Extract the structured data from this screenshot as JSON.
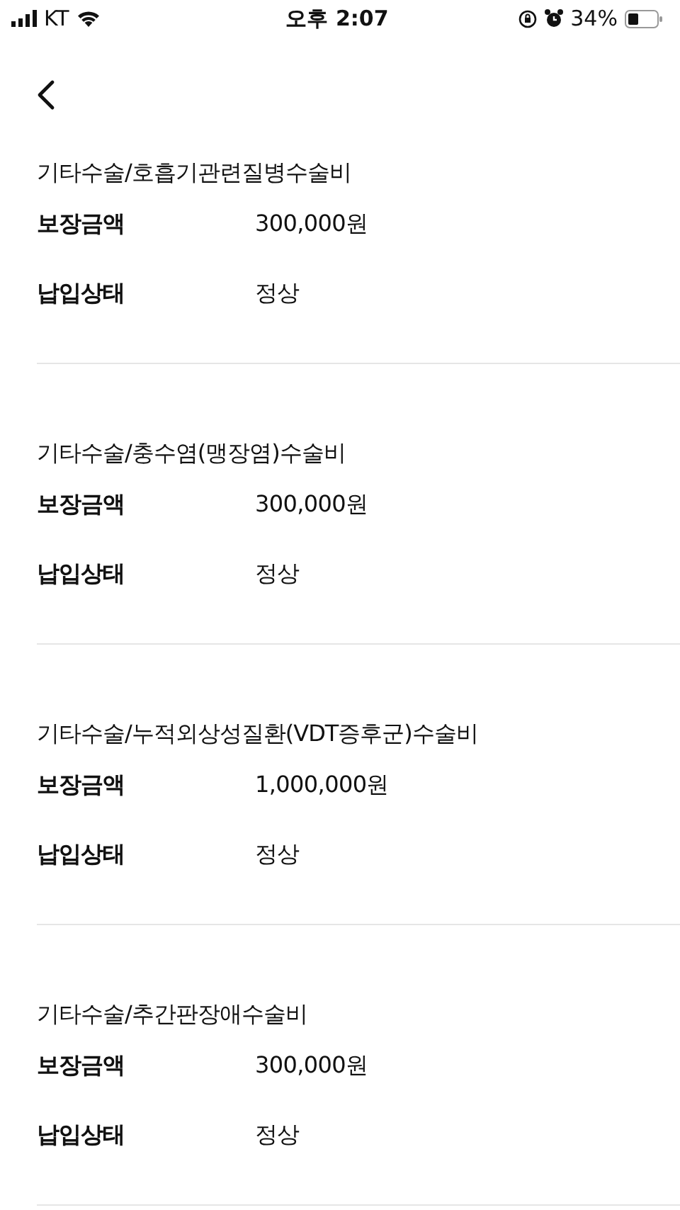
{
  "status_bar": {
    "carrier": "KT",
    "time": "오후 2:07",
    "battery": "34%"
  },
  "coverages": [
    {
      "title": "기타수술/호흡기관련질병수술비",
      "rows": [
        {
          "label": "보장금액",
          "value": "300,000원"
        },
        {
          "label": "납입상태",
          "value": "정상"
        }
      ]
    },
    {
      "title": "기타수술/충수염(맹장염)수술비",
      "rows": [
        {
          "label": "보장금액",
          "value": "300,000원"
        },
        {
          "label": "납입상태",
          "value": "정상"
        }
      ]
    },
    {
      "title": "기타수술/누적외상성질환(VDT증후군)수술비",
      "rows": [
        {
          "label": "보장금액",
          "value": "1,000,000원"
        },
        {
          "label": "납입상태",
          "value": "정상"
        }
      ]
    },
    {
      "title": "기타수술/추간판장애수술비",
      "rows": [
        {
          "label": "보장금액",
          "value": "300,000원"
        },
        {
          "label": "납입상태",
          "value": "정상"
        }
      ]
    }
  ]
}
